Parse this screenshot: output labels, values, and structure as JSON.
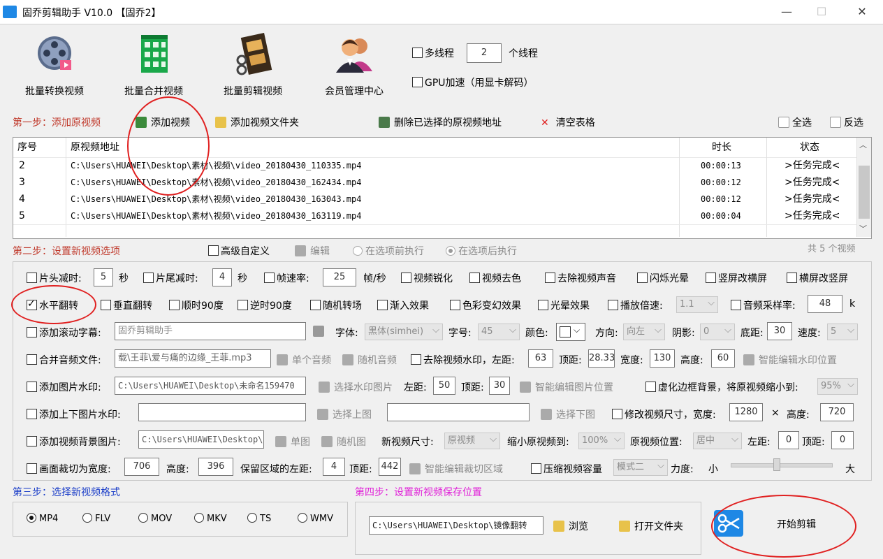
{
  "window": {
    "title": "固乔剪辑助手 V10.0 【固乔2】",
    "minimize": "—",
    "maximize": "☐",
    "close": "✕"
  },
  "toolbar": {
    "items": [
      {
        "label": "批量转换视频",
        "icon": "film-reel-convert-icon"
      },
      {
        "label": "批量合并视频",
        "icon": "green-building-merge-icon"
      },
      {
        "label": "批量剪辑视频",
        "icon": "film-strip-cut-icon"
      },
      {
        "label": "会员管理中心",
        "icon": "users-icon"
      }
    ],
    "multithread_label": "多线程",
    "thread_count": "2",
    "thread_unit": "个线程",
    "gpu_label": "GPU加速（用显卡解码）"
  },
  "step1": {
    "title": "第一步：添加原视频",
    "add_video": "添加视频",
    "add_folder": "添加视频文件夹",
    "delete_selected": "删除已选择的原视频地址",
    "clear_table": "清空表格",
    "select_all": "全选",
    "invert": "反选"
  },
  "table": {
    "headers": [
      "序号",
      "原视频地址",
      "时长",
      "状态"
    ],
    "rows": [
      {
        "no": "2",
        "path": "C:\\Users\\HUAWEI\\Desktop\\素材\\视频\\video_20180430_110335.mp4",
        "duration": "00:00:13",
        "status": ">任务完成<"
      },
      {
        "no": "3",
        "path": "C:\\Users\\HUAWEI\\Desktop\\素材\\视频\\video_20180430_162434.mp4",
        "duration": "00:00:12",
        "status": ">任务完成<"
      },
      {
        "no": "4",
        "path": "C:\\Users\\HUAWEI\\Desktop\\素材\\视频\\video_20180430_163043.mp4",
        "duration": "00:00:12",
        "status": ">任务完成<"
      },
      {
        "no": "5",
        "path": "C:\\Users\\HUAWEI\\Desktop\\素材\\视频\\video_20180430_163119.mp4",
        "duration": "00:00:04",
        "status": ">任务完成<"
      }
    ]
  },
  "step2": {
    "title": "第二步：设置新视频选项",
    "advanced": "高级自定义",
    "edit": "编辑",
    "before": "在选项前执行",
    "after": "在选项后执行",
    "count": "共 5 个视频"
  },
  "options": {
    "r1": {
      "head_cut": "片头减时:",
      "head_val": "5",
      "sec1": "秒",
      "tail_cut": "片尾减时:",
      "tail_val": "4",
      "sec2": "秒",
      "fps": "帧速率:",
      "fps_val": "25",
      "fps_unit": "帧/秒",
      "sharpen": "视频锐化",
      "decolor": "视频去色",
      "mute": "去除视频声音",
      "flash": "闪烁光晕",
      "v2h": "竖屏改横屏",
      "h2v": "横屏改竖屏"
    },
    "r2": {
      "hflip": "水平翻转",
      "vflip": "垂直翻转",
      "cw90": "顺时90度",
      "ccw90": "逆时90度",
      "random_trans": "随机转场",
      "fade_in": "渐入效果",
      "color_fx": "色彩变幻效果",
      "glow": "光晕效果",
      "speed": "播放倍速:",
      "speed_val": "1.1",
      "sample": "音频采样率:",
      "sample_val": "48",
      "sample_unit": "k"
    },
    "r3": {
      "subtitle": "添加滚动字幕:",
      "subtitle_val": "固乔剪辑助手",
      "font": "字体:",
      "font_val": "黑体(simhei)",
      "size": "字号:",
      "size_val": "45",
      "color": "颜色:",
      "dir": "方向:",
      "dir_val": "向左",
      "shadow": "阴影:",
      "shadow_val": "0",
      "bottom": "底距:",
      "bottom_val": "30",
      "speed": "速度:",
      "speed_val": "5"
    },
    "r4": {
      "merge_audio": "合并音频文件:",
      "audio_val": "载\\王菲\\爱与痛的边缘_王菲.mp3",
      "single": "单个音频",
      "random": "随机音频",
      "remove_wm": "去除视频水印，左距:",
      "left_val": "63",
      "top": "顶距:",
      "top_val": "28.33",
      "width": "宽度:",
      "width_val": "130",
      "height": "高度:",
      "height_val": "60",
      "smart": "智能编辑水印位置"
    },
    "r5": {
      "img_wm": "添加图片水印:",
      "img_val": "C:\\Users\\HUAWEI\\Desktop\\未命名159470",
      "select": "选择水印图片",
      "left": "左距:",
      "left_val": "50",
      "top": "顶距:",
      "top_val": "30",
      "smart": "智能编辑图片位置",
      "blur": "虚化边框背景，将原视频缩小到:",
      "blur_val": "95%"
    },
    "r6": {
      "updown": "添加上下图片水印:",
      "sel_top": "选择上图",
      "sel_bottom": "选择下图",
      "resize": "修改视频尺寸，宽度:",
      "w_val": "1280",
      "x": "×",
      "h": "高度:",
      "h_val": "720"
    },
    "r7": {
      "bg": "添加视频背景图片:",
      "bg_val": "C:\\Users\\HUAWEI\\Desktop\\",
      "single": "单图",
      "random": "随机图",
      "newsize": "新视频尺寸:",
      "newsize_val": "原视频",
      "shrink": "缩小原视频到:",
      "shrink_val": "100%",
      "pos": "原视频位置:",
      "pos_val": "居中",
      "left": "左距:",
      "left_val": "0",
      "top": "顶距:",
      "top_val": "0"
    },
    "r8": {
      "crop": "画面裁切为宽度:",
      "crop_w": "706",
      "h": "高度:",
      "crop_h": "396",
      "keep": "保留区域的左距:",
      "keep_left": "4",
      "top": "顶距:",
      "keep_top": "442",
      "smart": "智能编辑裁切区域",
      "compress": "压缩视频容量",
      "mode_val": "模式二",
      "force": "力度:",
      "small": "小",
      "big": "大",
      "force_level": 0.45
    }
  },
  "step3": {
    "title": "第三步：选择新视频格式",
    "formats": [
      "MP4",
      "FLV",
      "MOV",
      "MKV",
      "TS",
      "WMV"
    ],
    "selected": "MP4"
  },
  "step4": {
    "title": "第四步：设置新视频保存位置",
    "path": "C:\\Users\\HUAWEI\\Desktop\\镜像翻转",
    "browse": "浏览",
    "open_folder": "打开文件夹"
  },
  "start": {
    "label": "开始剪辑"
  },
  "colors": {
    "accent_red": "#c0392b",
    "step_blue": "#1a3dc8",
    "step_magenta": "#e020d8",
    "annotation_red": "#e02020"
  }
}
